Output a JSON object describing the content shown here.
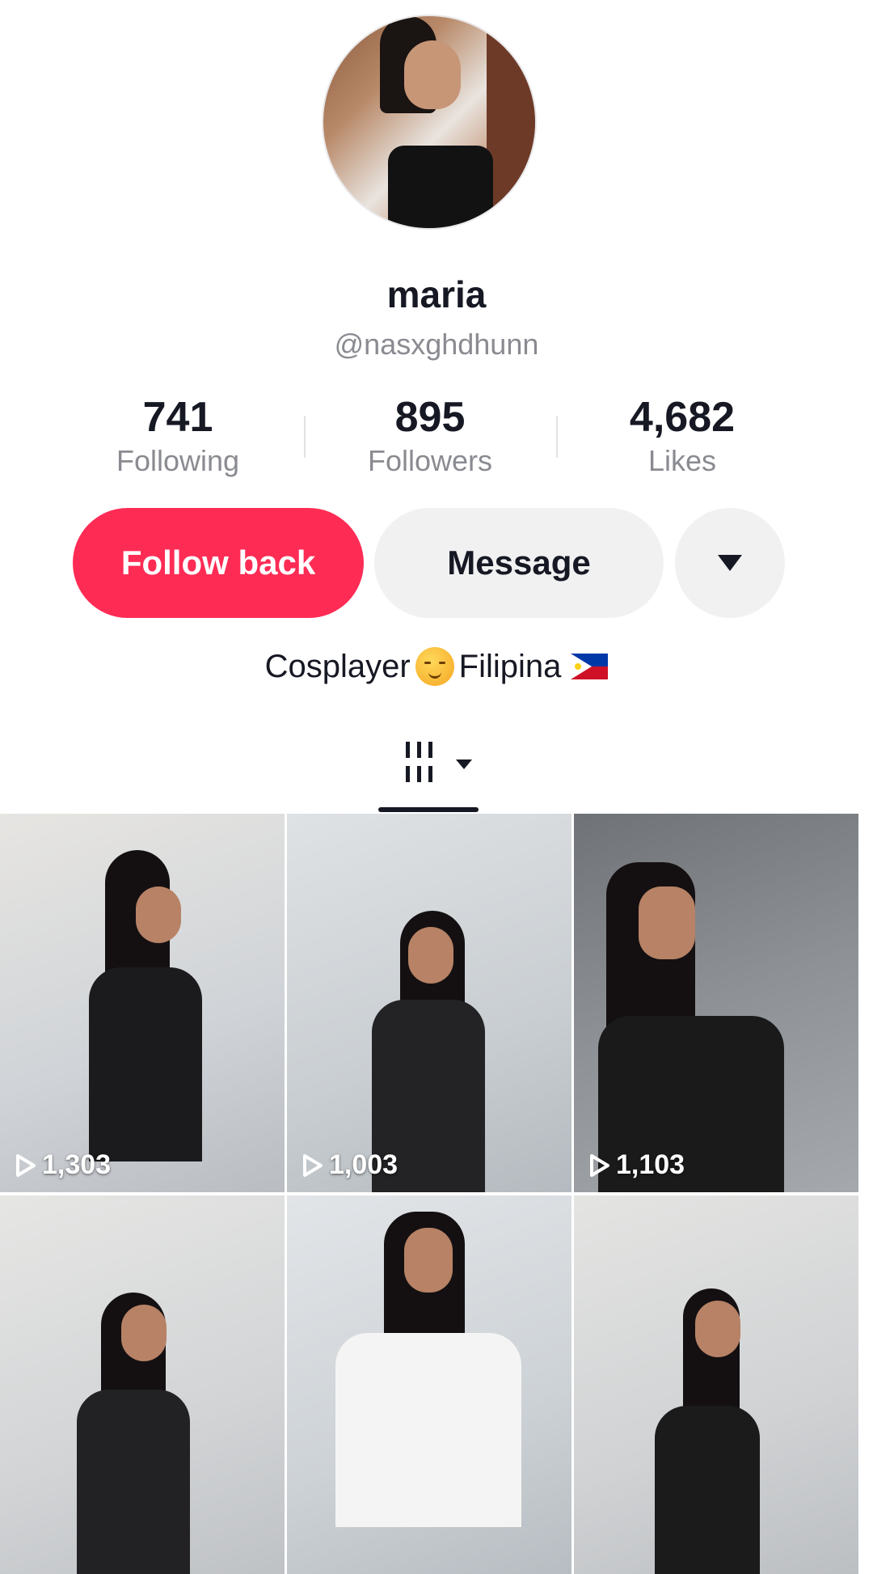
{
  "profile": {
    "name": "maria",
    "handle": "@nasxghdhunn",
    "bio_text_1": "Cosplayer",
    "bio_text_2": "Filipina"
  },
  "stats": [
    {
      "value": "741",
      "label": "Following"
    },
    {
      "value": "895",
      "label": "Followers"
    },
    {
      "value": "4,682",
      "label": "Likes"
    }
  ],
  "actions": {
    "follow_label": "Follow back",
    "message_label": "Message",
    "more_icon": "caret-down-icon"
  },
  "colors": {
    "primary": "#fe2c55",
    "secondary_button": "#f1f1f2",
    "text": "#161823",
    "muted": "#8a8b91"
  },
  "videos": [
    {
      "views": "1,303"
    },
    {
      "views": "1,003"
    },
    {
      "views": "1,103"
    },
    {
      "views": ""
    },
    {
      "views": ""
    },
    {
      "views": ""
    }
  ]
}
